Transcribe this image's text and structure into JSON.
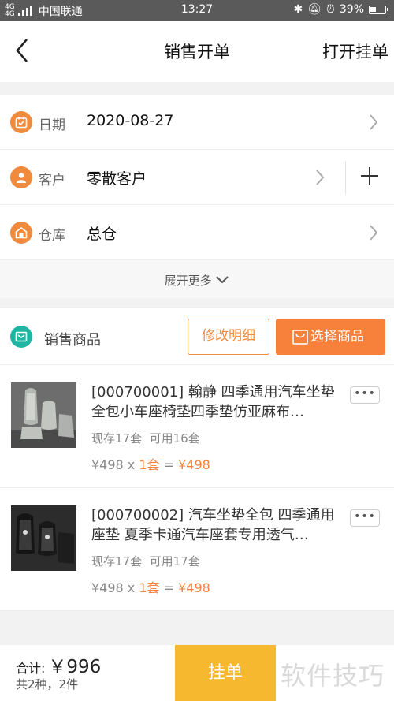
{
  "status_bar": {
    "network": "4G 4G",
    "carrier": "中国联通",
    "time": "13:27",
    "battery": "39%"
  },
  "header": {
    "title": "销售开单",
    "open_pending_label": "打开挂单"
  },
  "form": {
    "date": {
      "label": "日期",
      "value": "2020-08-27",
      "icon": "calendar-icon"
    },
    "customer": {
      "label": "客户",
      "value": "零散客户",
      "icon": "customer-icon"
    },
    "warehouse": {
      "label": "仓库",
      "value": "总仓",
      "icon": "warehouse-icon"
    },
    "expand_label": "展开更多"
  },
  "goods": {
    "title": "销售商品",
    "edit_label": "修改明细",
    "select_label": "选择商品",
    "items": [
      {
        "name": "[000700001] 翰静 四季通用汽车坐垫全包小车座椅垫四季垫仿亚麻布…",
        "stock": "现存17套",
        "available": "可用16套",
        "unit_price": "¥498",
        "qty_sep": " x ",
        "qty": "1套",
        "eq": " = ",
        "total": "¥498",
        "more": "•••"
      },
      {
        "name": "[000700002] 汽车坐垫全包 四季通用座垫 夏季卡通汽车座套专用透气…",
        "stock": "现存17套",
        "available": "可用17套",
        "unit_price": "¥498",
        "qty_sep": " x ",
        "qty": "1套",
        "eq": " = ",
        "total": "¥498",
        "more": "•••"
      }
    ]
  },
  "footer": {
    "total_label": "合计:",
    "total_amount": "￥996",
    "count_text": "共2种，2件",
    "hang_label": "挂单",
    "watermark": "软件技巧"
  },
  "colors": {
    "accent": "#f7813b",
    "hang_button": "#f5b82e",
    "goods_icon": "#1fb5a3"
  }
}
